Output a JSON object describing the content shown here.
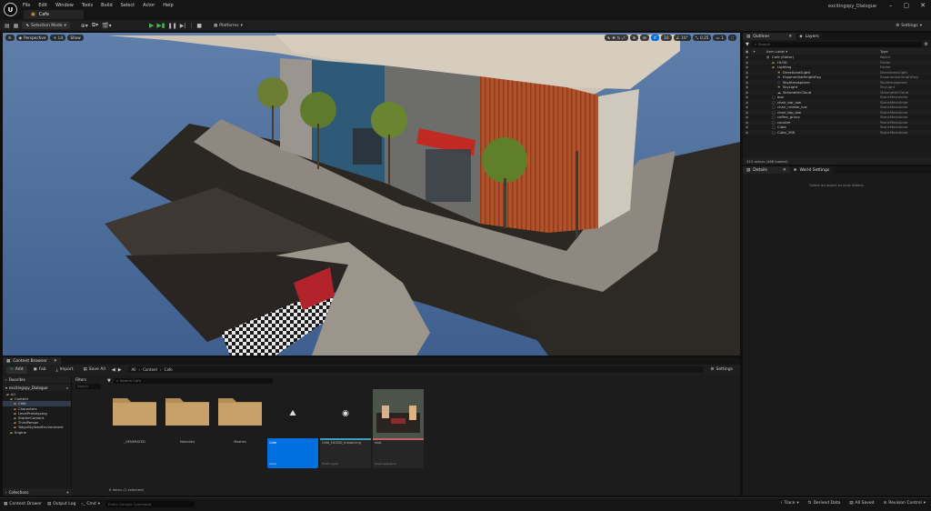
{
  "app": {
    "logo": "U",
    "menu": [
      "File",
      "Edit",
      "Window",
      "Tools",
      "Build",
      "Select",
      "Actor",
      "Help"
    ],
    "project_name": "excitingspy_Dialogue",
    "level_tab": "Cafe"
  },
  "toolbar": {
    "selection_mode": "Selection Mode",
    "platforms": "Platforms",
    "settings": "Settings"
  },
  "viewport": {
    "perspective": "Perspective",
    "lit": "Lit",
    "show": "Show",
    "snap_move": "10",
    "snap_rot": "10°",
    "snap_scale": "0.25",
    "cam_speed": "1"
  },
  "outliner": {
    "tab_outliner": "Outliner",
    "tab_layers": "Layers",
    "search_placeholder": "Search",
    "col_label": "Item Label ▾",
    "col_type": "Type",
    "rows": [
      {
        "label": "Cafe (Editor)",
        "type": "World",
        "indent": 0,
        "kind": "world"
      },
      {
        "label": "HLOD",
        "type": "Folder",
        "indent": 1,
        "kind": "folder"
      },
      {
        "label": "Lighting",
        "type": "Folder",
        "indent": 1,
        "kind": "folder"
      },
      {
        "label": "DirectionalLight",
        "type": "DirectionalLight",
        "indent": 2,
        "kind": "light"
      },
      {
        "label": "ExponentialHeightFog",
        "type": "ExponentialHeightFog",
        "indent": 2,
        "kind": "fog"
      },
      {
        "label": "SkyAtmosphere",
        "type": "SkyAtmosphere",
        "indent": 2,
        "kind": "sky"
      },
      {
        "label": "SkyLight",
        "type": "SkyLight",
        "indent": 2,
        "kind": "light"
      },
      {
        "label": "VolumetricCloud",
        "type": "VolumetricCloud",
        "indent": 2,
        "kind": "cloud"
      },
      {
        "label": "box",
        "type": "StaticMeshActor",
        "indent": 1,
        "kind": "mesh"
      },
      {
        "label": "chair_bar_low",
        "type": "StaticMeshActor",
        "indent": 1,
        "kind": "mesh"
      },
      {
        "label": "chair_middle_low",
        "type": "StaticMeshActor",
        "indent": 1,
        "kind": "mesh"
      },
      {
        "label": "chair_top_low",
        "type": "StaticMeshActor",
        "indent": 1,
        "kind": "mesh"
      },
      {
        "label": "coffee_grizzy",
        "type": "StaticMeshActor",
        "indent": 1,
        "kind": "mesh"
      },
      {
        "label": "counter",
        "type": "StaticMeshActor",
        "indent": 1,
        "kind": "mesh"
      },
      {
        "label": "Cube",
        "type": "StaticMeshActor",
        "indent": 1,
        "kind": "mesh"
      },
      {
        "label": "Cube_208",
        "type": "StaticMeshActor",
        "indent": 1,
        "kind": "mesh"
      }
    ],
    "actor_count": "415 actors (466 loaded)"
  },
  "details": {
    "tab_details": "Details",
    "tab_world": "World Settings",
    "empty_message": "Select an object to view details."
  },
  "content_browser": {
    "tab": "Content Browser",
    "add": "Add",
    "fab": "Fab",
    "import": "Import",
    "save_all": "Save All",
    "breadcrumb": [
      "All",
      "Content",
      "Cafe"
    ],
    "settings": "Settings",
    "favorites": "Favorites",
    "project_root": "excitingspy_Dialogue",
    "filters": "Filters",
    "filters_input": "Search",
    "search_placeholder": "Search Cafe",
    "tree": [
      {
        "label": "All",
        "indent": 0
      },
      {
        "label": "Content",
        "indent": 1
      },
      {
        "label": "Cafe",
        "indent": 2,
        "selected": true
      },
      {
        "label": "Characters",
        "indent": 2
      },
      {
        "label": "LevelPrototyping",
        "indent": 2
      },
      {
        "label": "StarterContent",
        "indent": 2
      },
      {
        "label": "ThirdPerson",
        "indent": 2
      },
      {
        "label": "TokyoStylizedEnvironment",
        "indent": 2
      },
      {
        "label": "Engine",
        "indent": 1
      }
    ],
    "assets": [
      {
        "name": "_GENERATED",
        "kind": "folder"
      },
      {
        "name": "Materials",
        "kind": "folder"
      },
      {
        "name": "Meshes",
        "kind": "folder"
      },
      {
        "name": "Cafe",
        "kind": "level",
        "sub": "Level",
        "selected": true
      },
      {
        "name": "Cafe_HLOD0_Instancing",
        "kind": "hlod",
        "sub": "HLOD Layer"
      },
      {
        "name": "shot",
        "kind": "image",
        "sub": "Level Sequence"
      }
    ],
    "item_count": "6 items (1 selected)",
    "collections": "Collections"
  },
  "statusbar": {
    "content_drawer": "Content Drawer",
    "output_log": "Output Log",
    "cmd": "Cmd",
    "console_placeholder": "Enter Console Command",
    "trace": "Trace",
    "derived_data": "Derived Data",
    "all_saved": "All Saved",
    "revision_control": "Revision Control"
  },
  "colors": {
    "accent_blue": "#0070e0",
    "play_green": "#4caf50",
    "folder_tan": "#c09a62"
  }
}
